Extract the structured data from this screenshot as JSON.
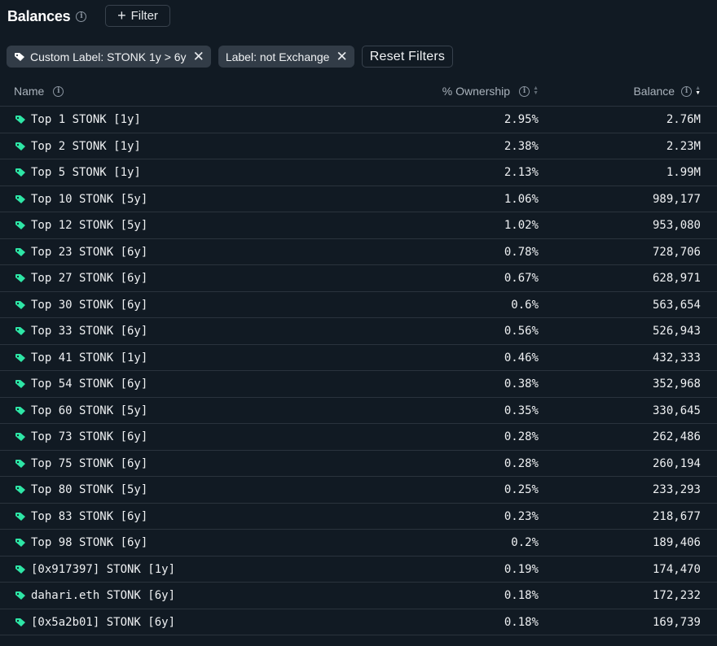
{
  "header": {
    "title": "Balances",
    "info_icon": "i",
    "filter_button": "Filter",
    "filter_plus": "+"
  },
  "filters": {
    "chips": [
      {
        "label": "Custom Label: STONK 1y > 6y",
        "icon": "tag-icon"
      },
      {
        "label": "Label: not Exchange"
      }
    ],
    "close_glyph": "✕",
    "reset_label": "Reset Filters"
  },
  "table": {
    "columns": {
      "name": "Name",
      "ownership": "% Ownership",
      "balance": "Balance"
    },
    "sort": {
      "column": "balance",
      "direction": "desc"
    },
    "tag_color": "#2ee6a6",
    "rows": [
      {
        "name": "Top 1 STONK [1y]",
        "ownership": "2.95%",
        "balance": "2.76M"
      },
      {
        "name": "Top 2 STONK [1y]",
        "ownership": "2.38%",
        "balance": "2.23M"
      },
      {
        "name": "Top 5 STONK [1y]",
        "ownership": "2.13%",
        "balance": "1.99M"
      },
      {
        "name": "Top 10 STONK [5y]",
        "ownership": "1.06%",
        "balance": "989,177"
      },
      {
        "name": "Top 12 STONK [5y]",
        "ownership": "1.02%",
        "balance": "953,080"
      },
      {
        "name": "Top 23 STONK [6y]",
        "ownership": "0.78%",
        "balance": "728,706"
      },
      {
        "name": "Top 27 STONK [6y]",
        "ownership": "0.67%",
        "balance": "628,971"
      },
      {
        "name": "Top 30 STONK [6y]",
        "ownership": "0.6%",
        "balance": "563,654"
      },
      {
        "name": "Top 33 STONK [6y]",
        "ownership": "0.56%",
        "balance": "526,943"
      },
      {
        "name": "Top 41 STONK [1y]",
        "ownership": "0.46%",
        "balance": "432,333"
      },
      {
        "name": "Top 54 STONK [6y]",
        "ownership": "0.38%",
        "balance": "352,968"
      },
      {
        "name": "Top 60 STONK [5y]",
        "ownership": "0.35%",
        "balance": "330,645"
      },
      {
        "name": "Top 73 STONK [6y]",
        "ownership": "0.28%",
        "balance": "262,486"
      },
      {
        "name": "Top 75 STONK [6y]",
        "ownership": "0.28%",
        "balance": "260,194"
      },
      {
        "name": "Top 80 STONK [5y]",
        "ownership": "0.25%",
        "balance": "233,293"
      },
      {
        "name": "Top 83 STONK [6y]",
        "ownership": "0.23%",
        "balance": "218,677"
      },
      {
        "name": "Top 98 STONK [6y]",
        "ownership": "0.2%",
        "balance": "189,406"
      },
      {
        "name": "[0x917397] STONK [1y]",
        "ownership": "0.19%",
        "balance": "174,470"
      },
      {
        "name": "dahari.eth STONK [6y]",
        "ownership": "0.18%",
        "balance": "172,232"
      },
      {
        "name": "[0x5a2b01] STONK [6y]",
        "ownership": "0.18%",
        "balance": "169,739"
      }
    ]
  }
}
